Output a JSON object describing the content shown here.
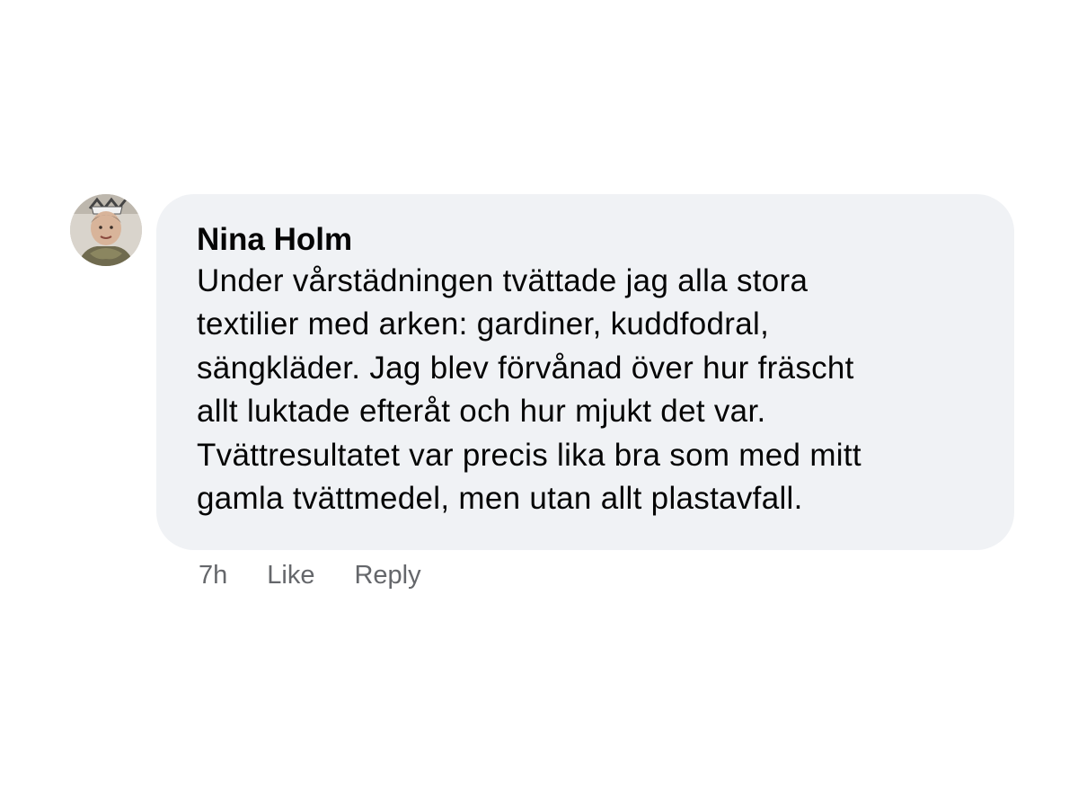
{
  "comment": {
    "author": "Nina Holm",
    "text": "Under vårstädningen tvättade jag alla stora\ntextilier med arken: gardiner, kuddfodral,\nsängkläder. Jag blev förvånad över hur fräscht\nallt luktade efteråt och hur mjukt det var.\nTvättresultatet var precis lika bra som med mitt\ngamla tvättmedel, men utan allt plastavfall.",
    "avatar_icon": "user-avatar-photo"
  },
  "actions": {
    "time": "7h",
    "like_label": "Like",
    "reply_label": "Reply"
  },
  "colors": {
    "bubble_bg": "#f0f2f5",
    "text": "#050505",
    "secondary_text": "#65676b"
  }
}
